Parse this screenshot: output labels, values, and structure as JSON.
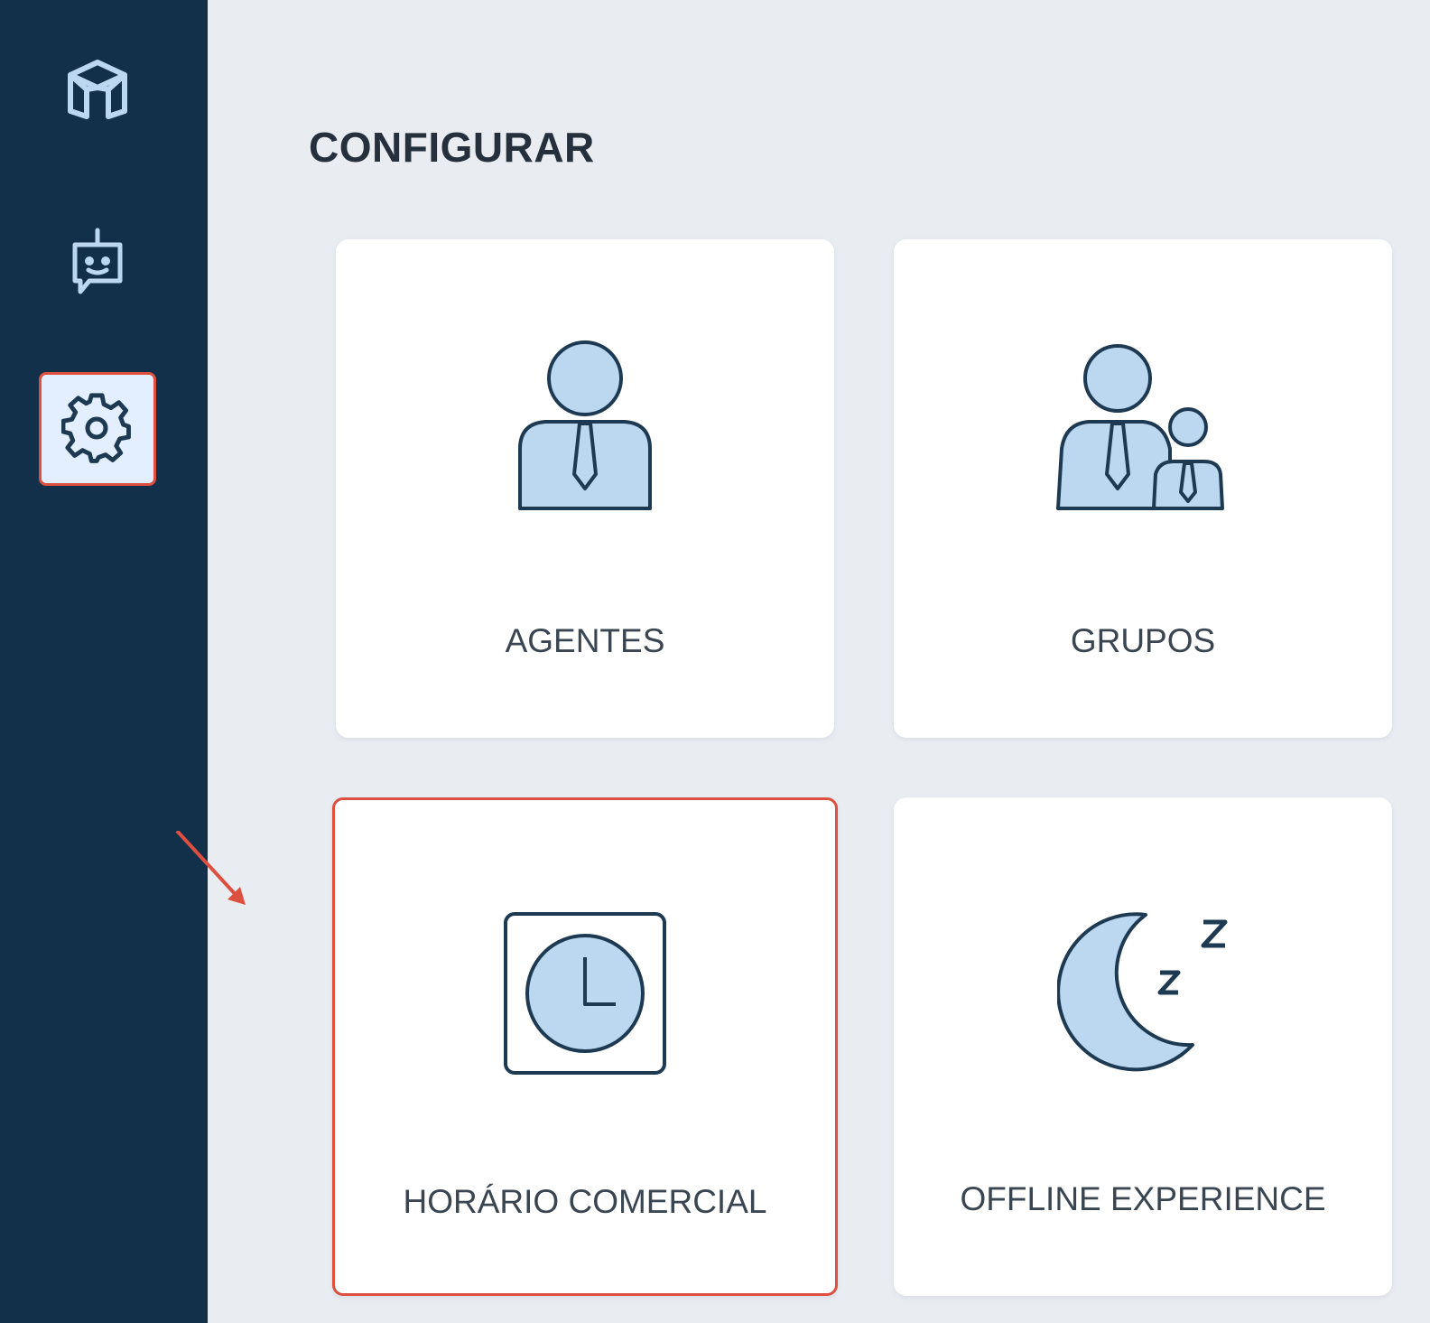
{
  "sidebar": {
    "items": [
      {
        "icon": "cube-icon",
        "active": false
      },
      {
        "icon": "chatbot-icon",
        "active": false
      },
      {
        "icon": "gear-icon",
        "active": true
      }
    ]
  },
  "main": {
    "title": "CONFIGURAR",
    "cards": [
      {
        "label": "AGENTES",
        "icon": "agent-icon"
      },
      {
        "label": "GRUPOS",
        "icon": "groups-icon"
      },
      {
        "label": "HORÁRIO COMERCIAL",
        "icon": "clock-icon",
        "highlighted": true
      },
      {
        "label": "OFFLINE EXPERIENCE",
        "icon": "moon-sleep-icon"
      }
    ]
  },
  "colors": {
    "sidebar_bg": "#13304b",
    "page_bg": "#e9edf2",
    "icon_fill": "#bcd8f0",
    "icon_stroke": "#1e3a52",
    "highlight": "#dd4f3f"
  }
}
